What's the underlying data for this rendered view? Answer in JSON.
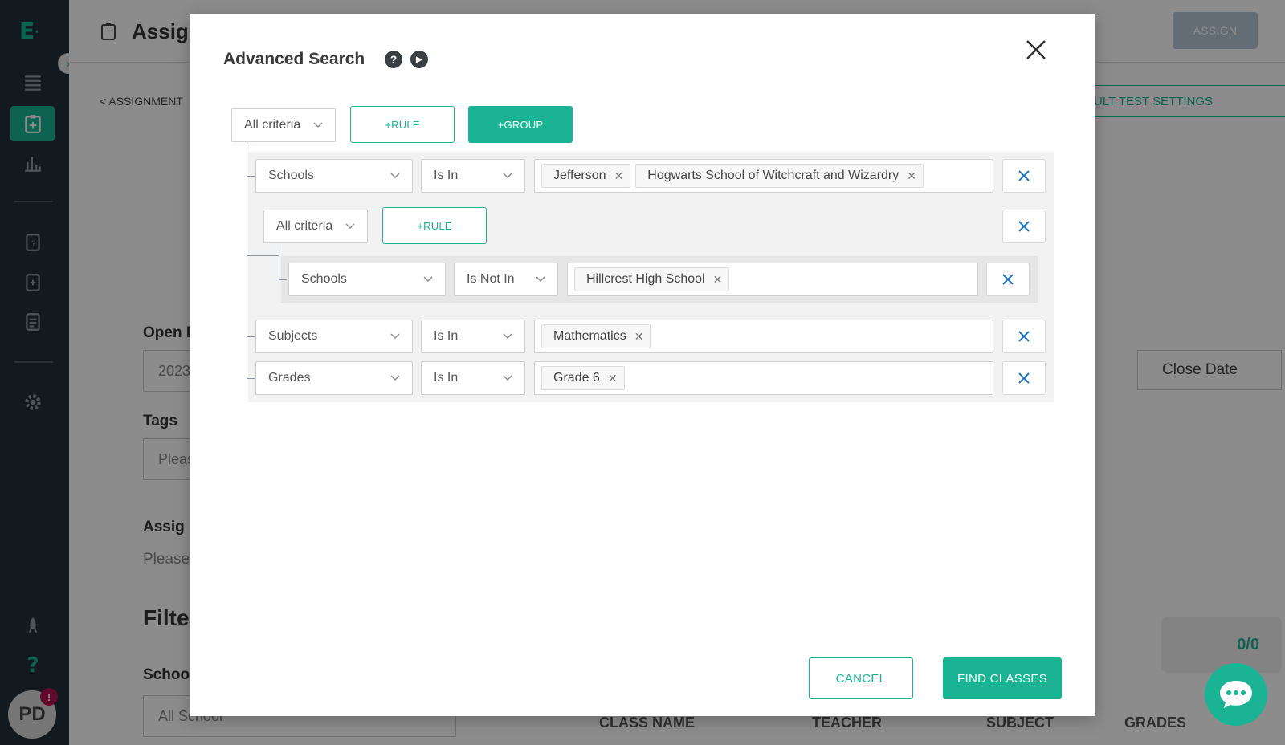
{
  "colors": {
    "accent": "#1ab394",
    "sidebar": "#223039",
    "delete_icon": "#1e73be",
    "badge": "#b5134f"
  },
  "sidebar": {
    "logo": "E",
    "icons": [
      "menu-icon",
      "assignment-icon",
      "reports-icon",
      "test-icon",
      "item-bank-icon",
      "playlist-icon",
      "settings-icon",
      "rocket-icon",
      "help-icon"
    ],
    "avatar_initials": "PD",
    "badge": "!"
  },
  "background": {
    "title": "Assign",
    "assign_button": "ASSIGN",
    "breadcrumb": "<  ASSIGNMENT",
    "settings_button": "ULT TEST SETTINGS",
    "open_date_label": "Open D",
    "open_date_value": "2023",
    "close_date": "Close Date",
    "tags_label": "Tags",
    "tags_placeholder": "Pleas",
    "assign_label": "Assig",
    "assign_text": "Please",
    "filter_heading": "Filte",
    "school_label": "School",
    "school_value": "All School",
    "count": "0/0",
    "table_headers": [
      "CLASS NAME",
      "TEACHER",
      "SUBJECT",
      "GRADES"
    ]
  },
  "modal": {
    "title": "Advanced Search",
    "root": {
      "criteria": "All criteria",
      "add_rule": "+RULE",
      "add_group": "+GROUP"
    },
    "rules": [
      {
        "field": "Schools",
        "operator": "Is In",
        "values": [
          "Jefferson",
          "Hogwarts School of Witchcraft and Wizardry"
        ]
      },
      {
        "field": "Subjects",
        "operator": "Is In",
        "values": [
          "Mathematics"
        ]
      },
      {
        "field": "Grades",
        "operator": "Is In",
        "values": [
          "Grade 6"
        ]
      }
    ],
    "subgroup": {
      "criteria": "All criteria",
      "add_rule": "+RULE",
      "rule": {
        "field": "Schools",
        "operator": "Is Not In",
        "values": [
          "Hillcrest High School"
        ]
      }
    },
    "cancel": "CANCEL",
    "find_classes": "FIND CLASSES"
  }
}
